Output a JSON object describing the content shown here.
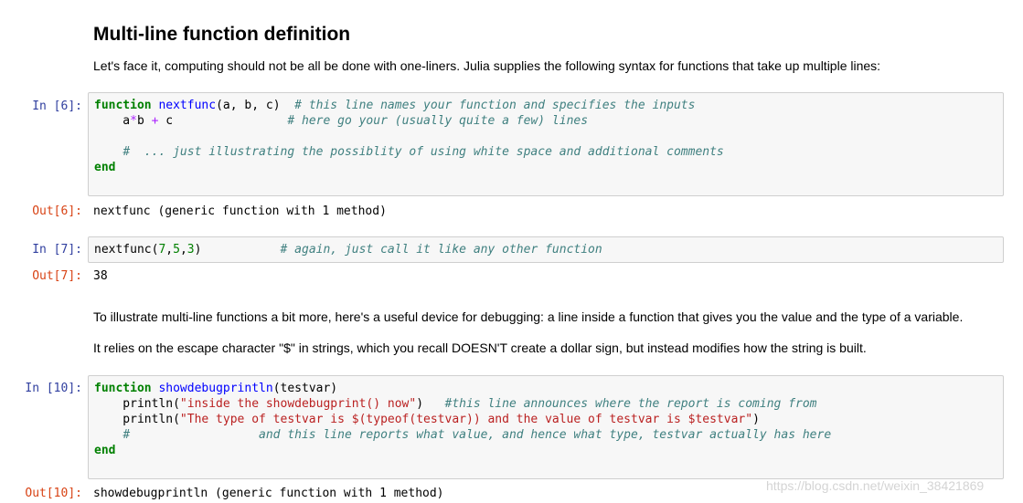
{
  "heading": "Multi-line function definition",
  "intro_text": "Let's face it, computing should not be all be done with one-liners. Julia supplies the following syntax for functions that take up multiple lines:",
  "cell6": {
    "in_prompt": "In [6]:",
    "out_prompt": "Out[6]:",
    "lines": [
      [
        {
          "t": "kw",
          "v": "function"
        },
        {
          "t": "p",
          "v": " "
        },
        {
          "t": "fn",
          "v": "nextfunc"
        },
        {
          "t": "p",
          "v": "(a, b, c)  "
        },
        {
          "t": "cm",
          "v": "# this line names your function and specifies the inputs"
        }
      ],
      [
        {
          "t": "p",
          "v": "    a"
        },
        {
          "t": "op",
          "v": "*"
        },
        {
          "t": "p",
          "v": "b "
        },
        {
          "t": "op",
          "v": "+"
        },
        {
          "t": "p",
          "v": " c                "
        },
        {
          "t": "cm",
          "v": "# here go your (usually quite a few) lines"
        }
      ],
      [],
      [
        {
          "t": "p",
          "v": "    "
        },
        {
          "t": "cm",
          "v": "#  ... just illustrating the possiblity of using white space and additional comments"
        }
      ],
      [
        {
          "t": "kw",
          "v": "end"
        }
      ]
    ],
    "output": "nextfunc (generic function with 1 method)"
  },
  "cell7": {
    "in_prompt": "In [7]:",
    "out_prompt": "Out[7]:",
    "lines": [
      [
        {
          "t": "p",
          "v": "nextfunc("
        },
        {
          "t": "num",
          "v": "7"
        },
        {
          "t": "p",
          "v": ","
        },
        {
          "t": "num",
          "v": "5"
        },
        {
          "t": "p",
          "v": ","
        },
        {
          "t": "num",
          "v": "3"
        },
        {
          "t": "p",
          "v": ")           "
        },
        {
          "t": "cm",
          "v": "# again, just call it like any other function"
        }
      ]
    ],
    "output": "38"
  },
  "para_debug": "To illustrate multi-line functions a bit more, here's a useful device for debugging: a line inside a function that gives you the value and the type of a variable.",
  "para_escape": "It relies on the escape character \"$\" in strings, which you recall DOESN'T create a dollar sign, but instead modifies how the string is built.",
  "cell10": {
    "in_prompt": "In [10]:",
    "out_prompt": "Out[10]:",
    "lines": [
      [
        {
          "t": "kw",
          "v": "function"
        },
        {
          "t": "p",
          "v": " "
        },
        {
          "t": "fn",
          "v": "showdebugprintln"
        },
        {
          "t": "p",
          "v": "(testvar)"
        }
      ],
      [
        {
          "t": "p",
          "v": "    println("
        },
        {
          "t": "str",
          "v": "\"inside the showdebugprint() now\""
        },
        {
          "t": "p",
          "v": ")   "
        },
        {
          "t": "cm",
          "v": "#this line announces where the report is coming from"
        }
      ],
      [
        {
          "t": "p",
          "v": "    println("
        },
        {
          "t": "str",
          "v": "\"The type of testvar is $(typeof(testvar)) and the value of testvar is $testvar\""
        },
        {
          "t": "p",
          "v": ")"
        }
      ],
      [
        {
          "t": "p",
          "v": "    "
        },
        {
          "t": "cm",
          "v": "#                  and this line reports what value, and hence what type, testvar actually has here"
        }
      ],
      [
        {
          "t": "kw",
          "v": "end"
        }
      ]
    ],
    "output": "showdebugprintln (generic function with 1 method)"
  },
  "watermark": "https://blog.csdn.net/weixin_38421869",
  "colors": {
    "in_prompt": "#303f9f",
    "out_prompt": "#d84315",
    "keyword": "#008000",
    "function_name": "#0000ff",
    "comment": "#408080",
    "operator": "#aa22ff",
    "string": "#ba2121",
    "cell_background": "#f7f7f7"
  }
}
